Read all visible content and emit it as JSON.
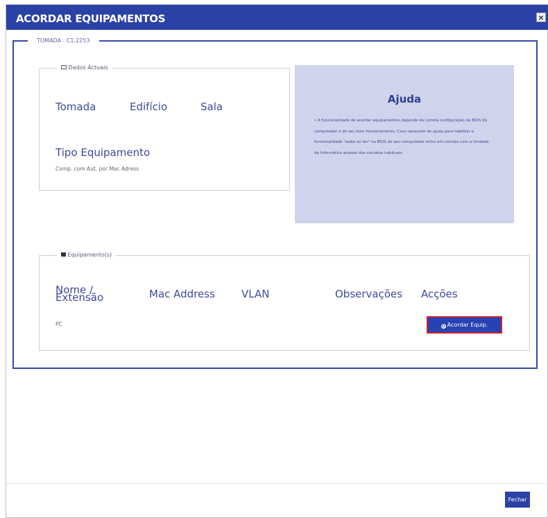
{
  "dialog": {
    "title": "ACORDAR EQUIPAMENTOS",
    "close_label": "×"
  },
  "tomada_legend": "TOMADA : C1.2253",
  "dados": {
    "legend": "Dados Actuais",
    "tomada_label": "Tomada",
    "edificio_label": "Edifício",
    "sala_label": "Sala",
    "tipo_label": "Tipo Equipamento",
    "tipo_value": "Comp. com Aut. por Mac Adress"
  },
  "help": {
    "title": "Ajuda",
    "text": "• A funcionalidade de acordar equipamentos depende da correta configuração da BIOS do computador e do seu bom funcionamento. Caso necessite de ajuda para habilitar a funcionalidade \"wake on lan\" na BIOS do seu computador entre em contato com a Unidade de Informática através dos contatos habituais."
  },
  "equip": {
    "legend": "Equipamento(s)",
    "columns": [
      "Nome / Extensão",
      "Mac Address",
      "VLAN",
      "Observações",
      "Acções"
    ],
    "rows": [
      {
        "nome": "PC",
        "mac": "",
        "vlan": "",
        "obs": "",
        "action_label": "Acordar Equip."
      }
    ]
  },
  "footer": {
    "close_button": "Fechar"
  },
  "colors": {
    "primary": "#2a41a6",
    "help_bg": "#cfd3ec",
    "highlight_border": "#d4202a"
  }
}
